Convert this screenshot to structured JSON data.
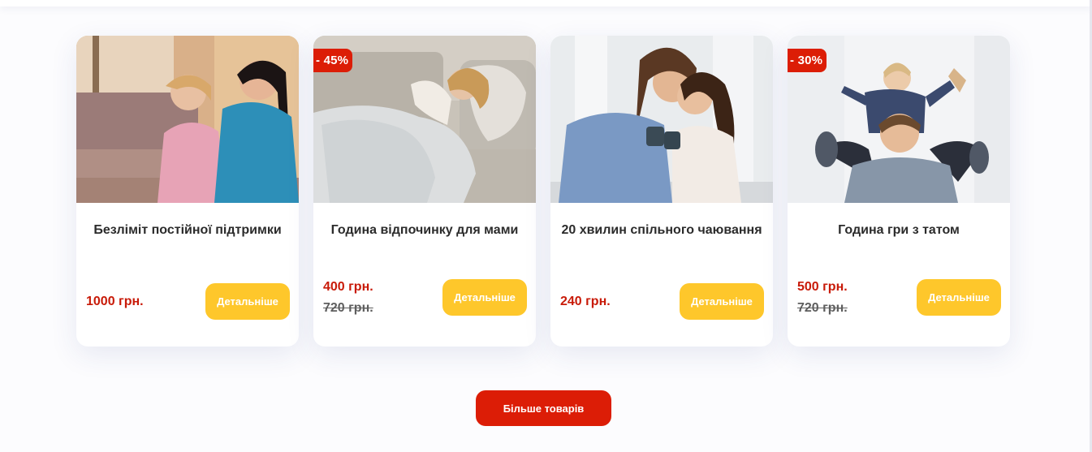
{
  "products": [
    {
      "title": "Безліміт постійної підтримки",
      "price": "1000 грн.",
      "details_label": "Детальніше",
      "photo_icon": "mother-daughter-sofa-image"
    },
    {
      "title": "Година відпочинку для мами",
      "price": "400 грн.",
      "old_price": "720 грн.",
      "badge": "- 45%",
      "details_label": "Детальніше",
      "photo_icon": "resting-mother-image"
    },
    {
      "title": "20 хвилин спільного чаювання",
      "price": "240 грн.",
      "details_label": "Детальніше",
      "photo_icon": "tea-together-image"
    },
    {
      "title": "Година гри з татом",
      "price": "500 грн.",
      "old_price": "720 грн.",
      "badge": "- 30%",
      "details_label": "Детальніше",
      "photo_icon": "father-son-play-image"
    }
  ],
  "more_button": {
    "label": "Більше товарів"
  },
  "colors": {
    "accent_red": "#dc1d06",
    "price_red": "#c81a08",
    "button_yellow": "#fec72b",
    "title_text": "#2b2b2b",
    "old_price_gray": "#5e5e5e"
  }
}
